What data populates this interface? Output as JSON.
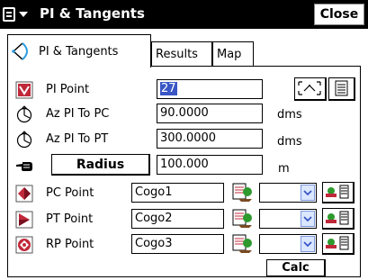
{
  "window": {
    "title": "PI & Tangents",
    "close_label": "Close"
  },
  "tabs": [
    {
      "label": "PI & Tangents",
      "active": true
    },
    {
      "label": "Results",
      "active": false
    },
    {
      "label": "Map",
      "active": false
    }
  ],
  "form": {
    "pi_point": {
      "label": "PI Point",
      "value": "27"
    },
    "az_pi_pc": {
      "label": "Az PI To PC",
      "value": "90.0000",
      "unit": "dms"
    },
    "az_pi_pt": {
      "label": "Az PI To PT",
      "value": "300.0000",
      "unit": "dms"
    },
    "radius": {
      "label": "Radius",
      "value": "100.000",
      "unit": "m"
    },
    "pc_point": {
      "label": "PC Point",
      "value": "Cogo1"
    },
    "pt_point": {
      "label": "PT Point",
      "value": "Cogo2"
    },
    "rp_point": {
      "label": "RP Point",
      "value": "Cogo3"
    }
  },
  "calc_label": "Calc",
  "colors": {
    "accent": "#3a57c6",
    "point_icon": "#c0283a",
    "picker_green": "#2e9a2e"
  }
}
